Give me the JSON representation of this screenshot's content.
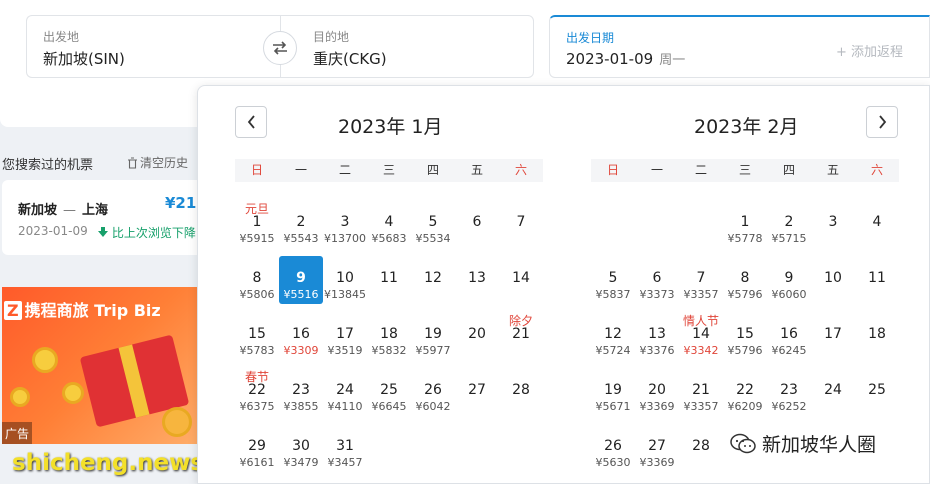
{
  "search": {
    "from_label": "出发地",
    "from_value": "新加坡(SIN)",
    "to_label": "目的地",
    "to_value": "重庆(CKG)",
    "date_label": "出发日期",
    "date_value": "2023-01-09",
    "date_weekday": "周一",
    "add_return": "+ 添加返程"
  },
  "history": {
    "title": "您搜索过的机票",
    "clear": "清空历史",
    "from": "新加坡",
    "dash": "—",
    "to": "上海",
    "price": "¥21",
    "date": "2023-01-09",
    "trend": "比上次浏览下降"
  },
  "banner": {
    "text": "携程商旅 Trip Biz",
    "ad": "广告"
  },
  "watermarks": {
    "left": "shicheng.news",
    "right": "新加坡华人圈"
  },
  "calendar": {
    "weekdays": [
      "日",
      "一",
      "二",
      "三",
      "四",
      "五",
      "六"
    ],
    "months": [
      {
        "title": "2023年 1月",
        "first_weekday": 0,
        "days": [
          {
            "d": "1",
            "p": "¥5915",
            "h": "元旦"
          },
          {
            "d": "2",
            "p": "¥5543"
          },
          {
            "d": "3",
            "p": "¥13700"
          },
          {
            "d": "4",
            "p": "¥5683"
          },
          {
            "d": "5",
            "p": "¥5534"
          },
          {
            "d": "6"
          },
          {
            "d": "7"
          },
          {
            "d": "8",
            "p": "¥5806"
          },
          {
            "d": "9",
            "p": "¥5516",
            "sel": true
          },
          {
            "d": "10",
            "p": "¥13845"
          },
          {
            "d": "11"
          },
          {
            "d": "12"
          },
          {
            "d": "13"
          },
          {
            "d": "14"
          },
          {
            "d": "15",
            "p": "¥5783"
          },
          {
            "d": "16",
            "p": "¥3309",
            "low": true
          },
          {
            "d": "17",
            "p": "¥3519"
          },
          {
            "d": "18",
            "p": "¥5832"
          },
          {
            "d": "19",
            "p": "¥5977"
          },
          {
            "d": "20"
          },
          {
            "d": "21",
            "h": "除夕"
          },
          {
            "d": "22",
            "p": "¥6375",
            "h": "春节"
          },
          {
            "d": "23",
            "p": "¥3855"
          },
          {
            "d": "24",
            "p": "¥4110"
          },
          {
            "d": "25",
            "p": "¥6645"
          },
          {
            "d": "26",
            "p": "¥6042"
          },
          {
            "d": "27"
          },
          {
            "d": "28"
          },
          {
            "d": "29",
            "p": "¥6161"
          },
          {
            "d": "30",
            "p": "¥3479"
          },
          {
            "d": "31",
            "p": "¥3457"
          }
        ]
      },
      {
        "title": "2023年 2月",
        "first_weekday": 3,
        "days": [
          {
            "d": "1",
            "p": "¥5778"
          },
          {
            "d": "2",
            "p": "¥5715"
          },
          {
            "d": "3"
          },
          {
            "d": "4"
          },
          {
            "d": "5",
            "p": "¥5837"
          },
          {
            "d": "6",
            "p": "¥3373"
          },
          {
            "d": "7",
            "p": "¥3357"
          },
          {
            "d": "8",
            "p": "¥5796"
          },
          {
            "d": "9",
            "p": "¥6060"
          },
          {
            "d": "10"
          },
          {
            "d": "11"
          },
          {
            "d": "12",
            "p": "¥5724"
          },
          {
            "d": "13",
            "p": "¥3376"
          },
          {
            "d": "14",
            "p": "¥3342",
            "low": true,
            "h": "情人节"
          },
          {
            "d": "15",
            "p": "¥5796"
          },
          {
            "d": "16",
            "p": "¥6245"
          },
          {
            "d": "17"
          },
          {
            "d": "18"
          },
          {
            "d": "19",
            "p": "¥5671"
          },
          {
            "d": "20",
            "p": "¥3369"
          },
          {
            "d": "21",
            "p": "¥3357"
          },
          {
            "d": "22",
            "p": "¥6209"
          },
          {
            "d": "23",
            "p": "¥6252"
          },
          {
            "d": "24"
          },
          {
            "d": "25"
          },
          {
            "d": "26",
            "p": "¥5630"
          },
          {
            "d": "27",
            "p": "¥3369"
          },
          {
            "d": "28"
          }
        ]
      }
    ]
  }
}
